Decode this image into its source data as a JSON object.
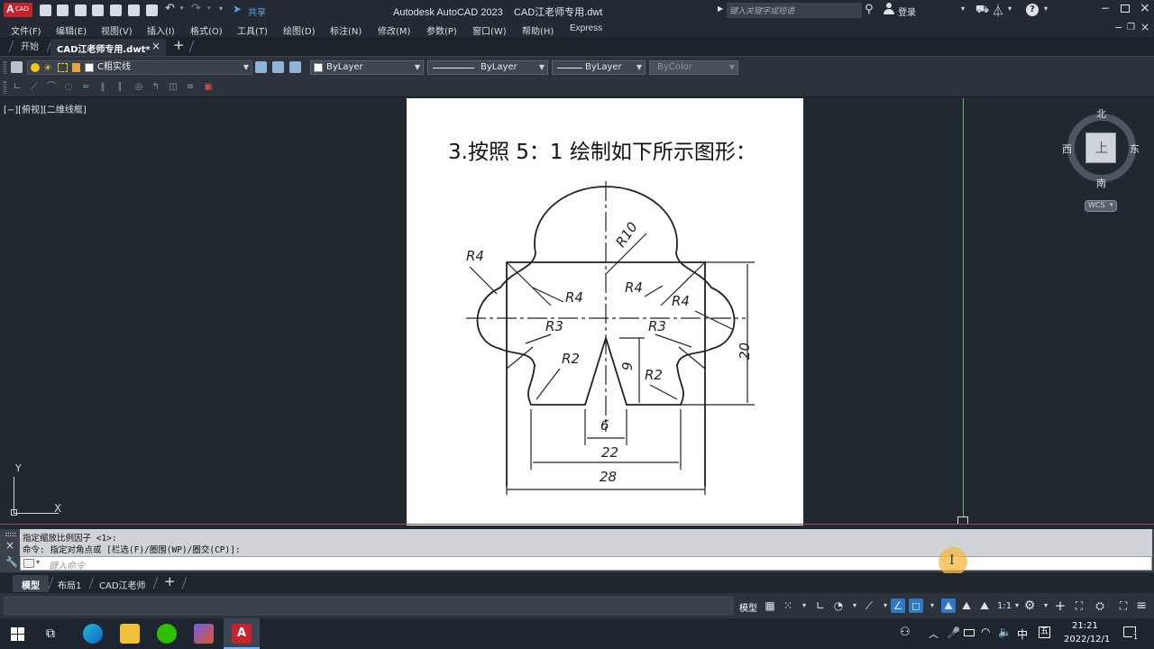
{
  "titlebar": {
    "app_badge": "A",
    "app_badge_sub": "CAD",
    "share_label": "共享",
    "title": "Autodesk AutoCAD 2023    CAD江老师专用.dwt",
    "search_placeholder": "键入关键字或短语",
    "login_label": "登录"
  },
  "menu": {
    "items": [
      "文件(F)",
      "编辑(E)",
      "视图(V)",
      "插入(I)",
      "格式(O)",
      "工具(T)",
      "绘图(D)",
      "标注(N)",
      "修改(M)",
      "参数(P)",
      "窗口(W)",
      "帮助(H)",
      "Express"
    ]
  },
  "tabs": {
    "start": "开始",
    "doc": "CAD江老师专用.dwt*",
    "close": "×",
    "add": "+"
  },
  "toolbar": {
    "layer_name": "C粗实线",
    "color": "ByLayer",
    "linetype": "ByLayer",
    "lineweight": "ByLayer",
    "plotstyle": "ByColor"
  },
  "viewport": {
    "label": "[−][俯视][二维线框]",
    "compass": {
      "north": "北",
      "south": "南",
      "east": "东",
      "west": "西",
      "top": "上",
      "wcs": "WCS"
    },
    "ucs_x": "X",
    "ucs_y": "Y"
  },
  "drawing": {
    "heading": "3.按照 5：1 绘制如下所示图形：",
    "labels": [
      "R4",
      "R10",
      "R4",
      "R4",
      "R4",
      "R3",
      "R3",
      "R2",
      "R2",
      "20",
      "9",
      "6",
      "22",
      "28"
    ]
  },
  "command": {
    "history1": "指定缩放比例因子 <1>:",
    "history2": "命令: 指定对角点或 [栏选(F)/圈围(WP)/圈交(CP)]:",
    "placeholder": "键入命令"
  },
  "layouts": {
    "tabs": [
      "模型",
      "布局1",
      "CAD江老师"
    ],
    "add": "+"
  },
  "status": {
    "model_label": "模型",
    "scale": "1:1"
  },
  "taskbar": {
    "ime": "中",
    "time": "21:21",
    "date": "2022/12/1",
    "notif_count": "1"
  }
}
